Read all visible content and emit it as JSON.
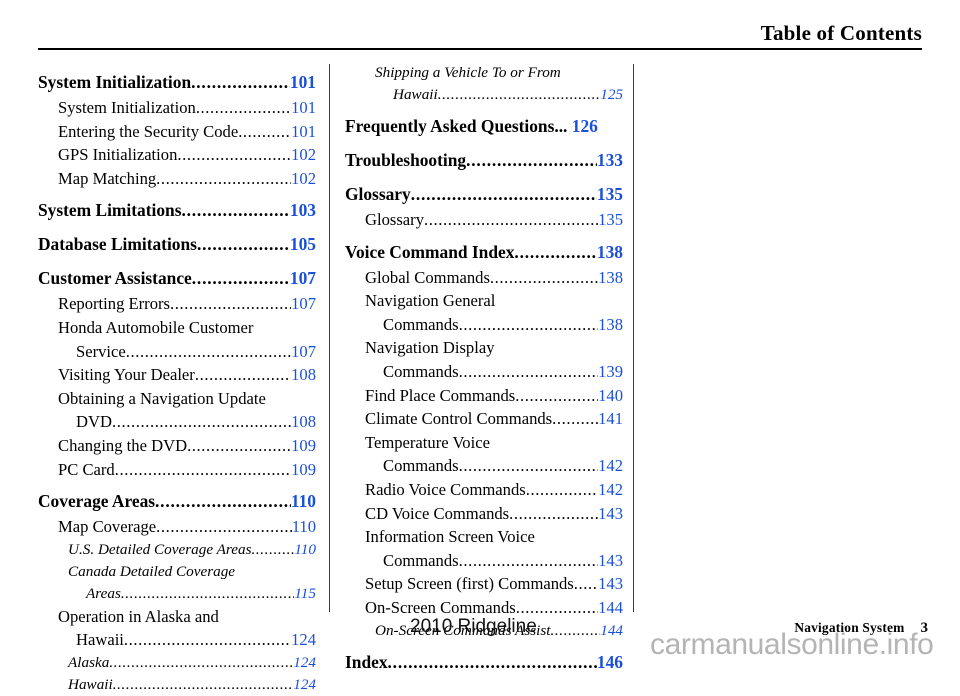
{
  "header": {
    "title": "Table of Contents"
  },
  "footer": {
    "model": "2010 Ridgeline",
    "section": "Navigation System",
    "page_number": "3",
    "watermark": "carmanualsonline.info"
  },
  "colors": {
    "page_number": "#1A4FD8",
    "text": "#000000",
    "watermark": "#b4b4b4",
    "rule": "#000000"
  },
  "toc": {
    "left_column": [
      {
        "level": 1,
        "text": "System Initialization",
        "page": "101"
      },
      {
        "level": 2,
        "text": "System Initialization",
        "page": "101"
      },
      {
        "level": 2,
        "text": "Entering the Security Code",
        "page": "101"
      },
      {
        "level": 2,
        "text": "GPS Initialization",
        "page": "102"
      },
      {
        "level": 2,
        "text": "Map Matching",
        "page": "102"
      },
      {
        "level": 1,
        "text": "System Limitations",
        "page": "103"
      },
      {
        "level": 1,
        "text": "Database Limitations",
        "page": "105"
      },
      {
        "level": 1,
        "text": "Customer Assistance",
        "page": "107"
      },
      {
        "level": 2,
        "text": "Reporting Errors",
        "page": "107"
      },
      {
        "level": 2,
        "text": "Honda Automobile Customer",
        "page": ""
      },
      {
        "level": 2,
        "text": "Service",
        "page": "107",
        "cont": true
      },
      {
        "level": 2,
        "text": "Visiting Your Dealer",
        "page": "108"
      },
      {
        "level": 2,
        "text": "Obtaining a Navigation Update",
        "page": ""
      },
      {
        "level": 2,
        "text": "DVD",
        "page": "108",
        "cont": true
      },
      {
        "level": 2,
        "text": "Changing the DVD",
        "page": "109"
      },
      {
        "level": 2,
        "text": "PC Card",
        "page": "109"
      },
      {
        "level": 1,
        "text": "Coverage Areas",
        "page": "110"
      },
      {
        "level": 2,
        "text": "Map Coverage",
        "page": "110"
      },
      {
        "level": 3,
        "text": "U.S. Detailed Coverage Areas",
        "page": "110"
      },
      {
        "level": 3,
        "text": "Canada Detailed Coverage",
        "page": ""
      },
      {
        "level": 3,
        "text": "Areas",
        "page": "115",
        "cont": true
      },
      {
        "level": 2,
        "text": "Operation in Alaska and",
        "page": ""
      },
      {
        "level": 2,
        "text": "Hawaii",
        "page": "124",
        "cont": true
      },
      {
        "level": 3,
        "text": "Alaska",
        "page": "124"
      },
      {
        "level": 3,
        "text": "Hawaii",
        "page": "124"
      }
    ],
    "right_column": [
      {
        "level": 3,
        "text": "Shipping a Vehicle To or From",
        "page": ""
      },
      {
        "level": 3,
        "text": "Hawaii",
        "page": "125",
        "cont": true
      },
      {
        "level": 1,
        "text": "Frequently Asked Questions...",
        "page": "126",
        "noleader": true
      },
      {
        "level": 1,
        "text": "Troubleshooting",
        "page": "133"
      },
      {
        "level": 1,
        "text": "Glossary",
        "page": "135"
      },
      {
        "level": 2,
        "text": "Glossary",
        "page": "135"
      },
      {
        "level": 1,
        "text": "Voice Command Index",
        "page": "138"
      },
      {
        "level": 2,
        "text": "Global Commands",
        "page": "138"
      },
      {
        "level": 2,
        "text": "Navigation General",
        "page": ""
      },
      {
        "level": 2,
        "text": "Commands",
        "page": "138",
        "cont": true
      },
      {
        "level": 2,
        "text": "Navigation Display",
        "page": ""
      },
      {
        "level": 2,
        "text": "Commands",
        "page": "139",
        "cont": true
      },
      {
        "level": 2,
        "text": "Find Place Commands",
        "page": "140"
      },
      {
        "level": 2,
        "text": "Climate Control Commands",
        "page": "141"
      },
      {
        "level": 2,
        "text": "Temperature Voice",
        "page": ""
      },
      {
        "level": 2,
        "text": "Commands",
        "page": "142",
        "cont": true
      },
      {
        "level": 2,
        "text": "Radio Voice Commands",
        "page": "142"
      },
      {
        "level": 2,
        "text": "CD Voice Commands",
        "page": "143"
      },
      {
        "level": 2,
        "text": "Information Screen Voice",
        "page": ""
      },
      {
        "level": 2,
        "text": "Commands",
        "page": "143",
        "cont": true
      },
      {
        "level": 2,
        "text": "Setup Screen (first) Commands",
        "page": "143"
      },
      {
        "level": 2,
        "text": "On-Screen Commands",
        "page": "144"
      },
      {
        "level": 3,
        "text": "On-Screen Commands Assist",
        "page": "144"
      },
      {
        "level": 1,
        "text": "Index",
        "page": "146"
      }
    ]
  }
}
